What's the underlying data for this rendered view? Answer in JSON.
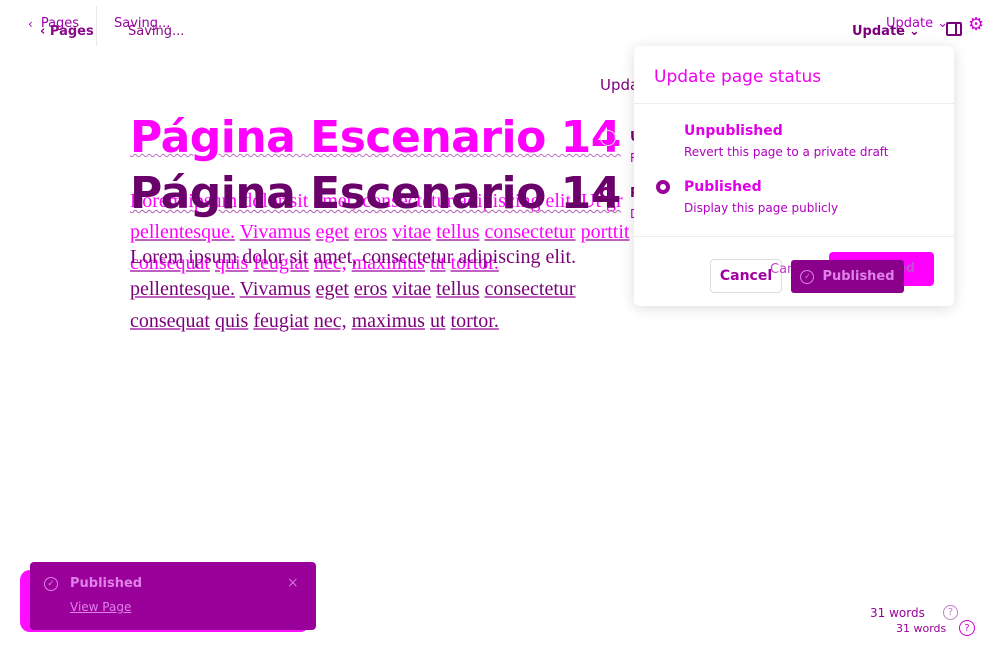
{
  "topbar": {
    "back_label": "Pages",
    "saving_label": "Saving...",
    "update_label": "Update"
  },
  "editor": {
    "title": "Página Escenario 14",
    "paragraph_first": "Lorem ipsum dolor sit amet, consectetur adipiscing elit. Ut gr",
    "paragraph": "Lorem ipsum dolor sit amet, consectetur adipiscing elit.",
    "line2_words": [
      "pellentesque.",
      "Vivamus",
      "eget",
      "eros",
      "vitae",
      "tellus",
      "consectetur",
      "porttit"
    ],
    "line3_words": [
      "consequat",
      "quis",
      "feugiat",
      "nec,",
      "maximus",
      "ut",
      "tortor."
    ]
  },
  "status_popover": {
    "title": "Update page status",
    "unpublished": {
      "label": "Unpublished",
      "description": "Revert this page to a private draft"
    },
    "published": {
      "label": "Published",
      "description": "Display this page publicly",
      "selected": true
    },
    "cancel_label": "Cancel",
    "publish_label": "Published"
  },
  "toast": {
    "title": "Published",
    "link": "View Page",
    "close": "×"
  },
  "footer": {
    "word_count": "31 words",
    "help_glyph": "?"
  },
  "colors": {
    "accent": "#ff00ff",
    "accent_dark": "#8a008a"
  }
}
